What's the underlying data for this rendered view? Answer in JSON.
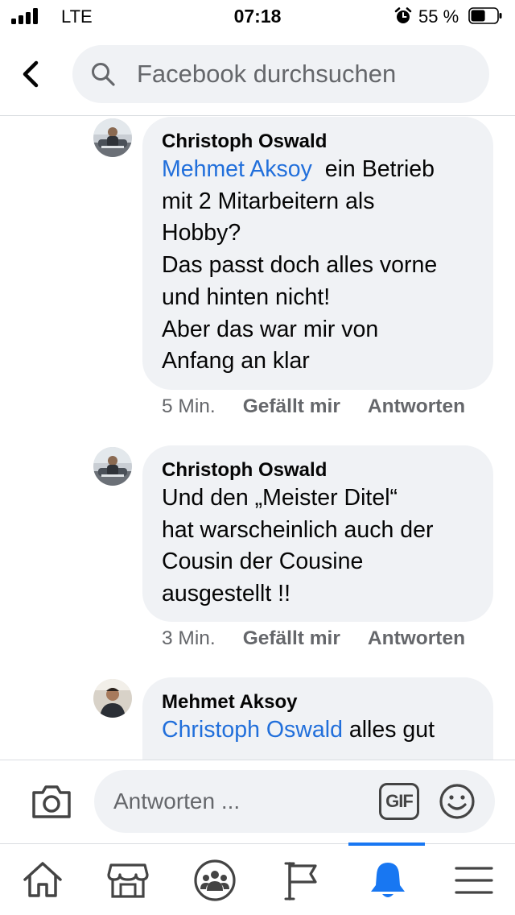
{
  "status_bar": {
    "carrier": "LTE",
    "time": "07:18",
    "battery_percent": "55 %",
    "battery_level": 0.55,
    "signal_bars": 4
  },
  "header": {
    "search_placeholder": "Facebook durchsuchen",
    "icons": [
      "back-arrow-icon",
      "search-icon"
    ]
  },
  "comments": [
    {
      "author": "Christoph Oswald",
      "mention": "Mehmet Aksoy",
      "lines": [
        "  ein Betrieb",
        "mit 2 Mitarbeitern als",
        "Hobby?",
        "Das passt doch alles vorne",
        "und hinten nicht!",
        "Aber das war mir von",
        "Anfang an klar"
      ],
      "time": "5 Min.",
      "like_label": "Gefällt mir",
      "reply_label": "Antworten"
    },
    {
      "author": "Christoph Oswald",
      "mention": "",
      "lines": [
        "Und den „Meister Ditel“",
        "hat warscheinlich auch der",
        "Cousin der Cousine",
        "ausgestellt !!"
      ],
      "time": "3 Min.",
      "like_label": "Gefällt mir",
      "reply_label": "Antworten"
    },
    {
      "author": "Mehmet Aksoy",
      "mention": "Christoph Oswald",
      "lines": [
        " alles gut"
      ]
    }
  ],
  "composer": {
    "placeholder": "Antworten ...",
    "gif_label": "GIF",
    "icons": [
      "camera-icon",
      "gif-icon",
      "emoji-icon"
    ]
  },
  "tabbar": {
    "tabs": [
      "home-icon",
      "marketplace-icon",
      "groups-icon",
      "pages-flag-icon",
      "notifications-bell-icon",
      "menu-icon"
    ],
    "active_tab": "notifications-bell-icon"
  },
  "colors": {
    "accent": "#1877f2",
    "mention": "#216fdb",
    "bubble": "#f0f2f5",
    "secondary_text": "#65676b"
  }
}
